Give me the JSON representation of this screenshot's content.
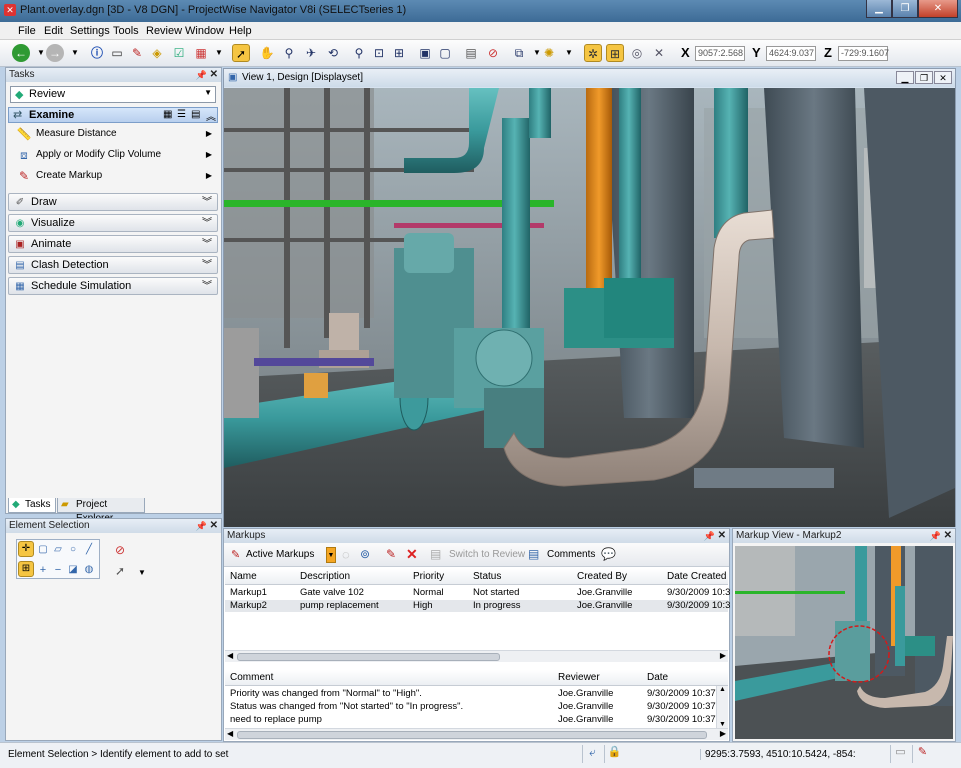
{
  "window": {
    "title": "Plant.overlay.dgn [3D - V8 DGN] - ProjectWise Navigator V8i (SELECTseries 1)"
  },
  "menu": [
    "File",
    "Edit",
    "Settings",
    "Tools",
    "Review",
    "Window",
    "Help"
  ],
  "coords": {
    "x_label": "X",
    "x_value": "9057:2.568",
    "y_label": "Y",
    "y_value": "4624:9.037",
    "z_label": "Z",
    "z_value": "-729:9.1607"
  },
  "tasks": {
    "header": "Tasks",
    "dropdown": "Review",
    "examine": "Examine",
    "examine_items": [
      "Measure Distance",
      "Apply or Modify Clip Volume",
      "Create Markup"
    ],
    "sections": [
      "Draw",
      "Visualize",
      "Animate",
      "Clash Detection",
      "Schedule Simulation"
    ],
    "tabs": [
      "Tasks",
      "Project Explorer"
    ]
  },
  "element_selection": {
    "header": "Element Selection"
  },
  "view": {
    "title": "View 1, Design [Displayset]"
  },
  "markups": {
    "header": "Markups",
    "toolbar": {
      "active": "Active Markups",
      "switch": "Switch to Review",
      "comments": "Comments"
    },
    "columns": [
      "Name",
      "Description",
      "Priority",
      "Status",
      "Created By",
      "Date Created"
    ],
    "rows": [
      [
        "Markup1",
        "Gate valve 102",
        "Normal",
        "Not started",
        "Joe.Granville",
        "9/30/2009 10:3"
      ],
      [
        "Markup2",
        "pump replacement",
        "High",
        "In progress",
        "Joe.Granville",
        "9/30/2009 10:3"
      ]
    ],
    "comment_columns": [
      "Comment",
      "Reviewer",
      "Date"
    ],
    "comments": [
      [
        "Priority was changed from \"Normal\" to \"High\".",
        "Joe.Granville",
        "9/30/2009 10:37:1"
      ],
      [
        "Status was changed from \"Not started\" to \"In progress\".",
        "Joe.Granville",
        "9/30/2009 10:37:1"
      ],
      [
        "need to replace pump",
        "Joe.Granville",
        "9/30/2009 10:37:3"
      ]
    ]
  },
  "markup_view": {
    "header": "Markup View - Markup2"
  },
  "status": {
    "prompt": "Element Selection > Identify element to add to set",
    "coords": "9295:3.7593, 4510:10.5424, -854:"
  }
}
